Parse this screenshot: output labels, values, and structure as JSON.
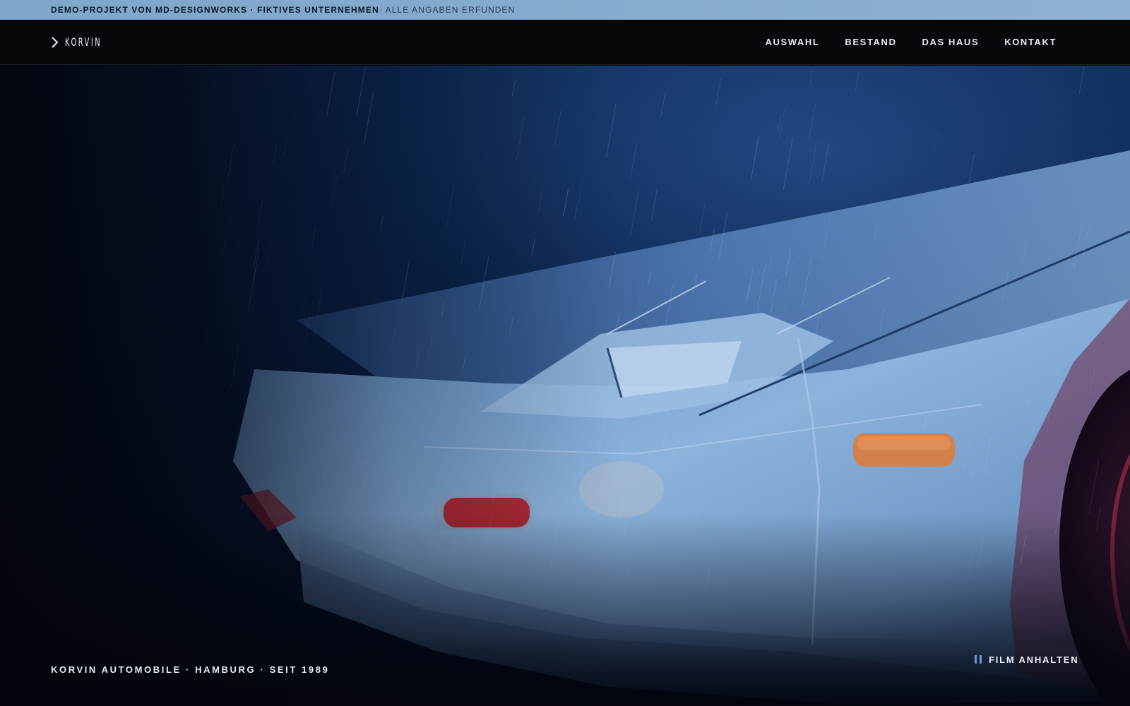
{
  "banner": {
    "strong_text": "DEMO-PROJEKT VON MD-DESIGNWORKS · FIKTIVES UNTERNEHMEN",
    "soft_text": " · ALLE ANGABEN ERFUNDEN"
  },
  "header": {
    "logo_text": "KORVIN",
    "nav": [
      {
        "label": "AUSWAHL"
      },
      {
        "label": "BESTAND"
      },
      {
        "label": "DAS HAUS"
      },
      {
        "label": "KONTAKT"
      }
    ]
  },
  "hero": {
    "caption": "KORVIN AUTOMOBILE · HAMBURG · SEIT 1989",
    "film_button_label": "FILM ANHALTEN",
    "film_button_icon": "pause-icon"
  },
  "colors": {
    "banner_bg": "#86acd0",
    "header_bg": "#06080c",
    "accent": "#6f95d8"
  }
}
